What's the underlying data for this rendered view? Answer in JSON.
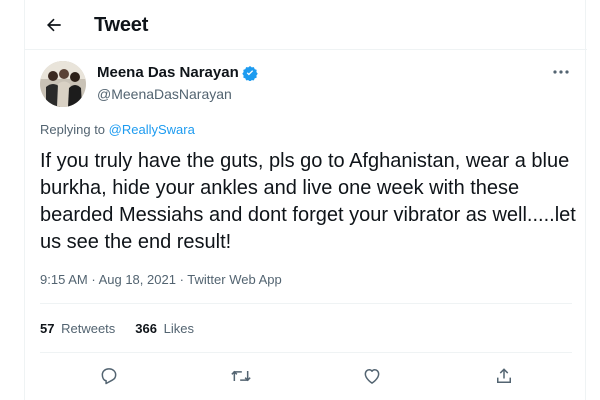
{
  "header": {
    "back_icon": "arrow-left-icon",
    "title": "Tweet"
  },
  "author": {
    "name": "Meena Das Narayan",
    "handle": "@MeenaDasNarayan",
    "verified": true,
    "verified_icon": "verified-badge-icon",
    "more_icon": "more-horizontal-icon"
  },
  "reply": {
    "prefix": "Replying to",
    "to": "@ReallySwara"
  },
  "tweet": {
    "text": "If you truly have the guts, pls go to Afghanistan, wear a blue burkha, hide your ankles and live one week with these bearded Messiahs and dont forget your vibrator as well.....let us see the end result!"
  },
  "meta": {
    "time": "9:15 AM",
    "date": "Aug 18, 2021",
    "app": "Twitter Web App",
    "sep": "·"
  },
  "stats": {
    "retweets_count": "57",
    "retweets_label": "Retweets",
    "likes_count": "366",
    "likes_label": "Likes"
  },
  "actions": [
    "reply-icon",
    "retweet-icon",
    "like-icon",
    "share-icon"
  ],
  "colors": {
    "accent": "#1d9bf0",
    "text": "#0f1419",
    "secondary": "#536471",
    "border": "#eff3f4"
  }
}
